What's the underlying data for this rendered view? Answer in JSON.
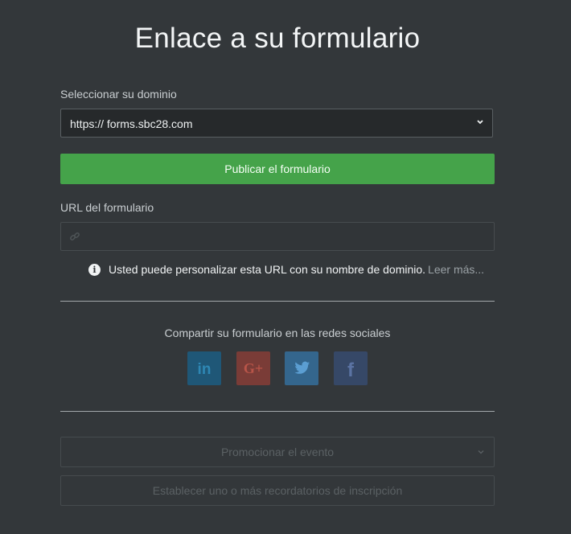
{
  "header": {
    "title": "Enlace a su formulario"
  },
  "domain": {
    "label": "Seleccionar su dominio",
    "selected": "https:// forms.sbc28.com",
    "chevron_icon": "chevron-down-icon"
  },
  "publish": {
    "label": "Publicar el formulario",
    "color": "#45a34a"
  },
  "form_url": {
    "label": "URL del formulario",
    "value": "",
    "icon": "link-icon"
  },
  "info": {
    "icon": "info-icon",
    "text": "Usted puede personalizar esta URL con su nombre de dominio.",
    "link": "Leer más..."
  },
  "share": {
    "label": "Compartir su formulario en las redes sociales",
    "networks": [
      {
        "name": "linkedin-icon",
        "glyph": "in",
        "color": "#1f5777"
      },
      {
        "name": "google-plus-icon",
        "glyph": "G+",
        "color": "#7a3c37"
      },
      {
        "name": "twitter-icon",
        "glyph": "",
        "color": "#34668d"
      },
      {
        "name": "facebook-icon",
        "glyph": "f",
        "color": "#364867"
      }
    ]
  },
  "promote": {
    "label": "Promocionar el evento"
  },
  "reminders": {
    "label": "Establecer uno o más recordatorios de inscripción"
  }
}
